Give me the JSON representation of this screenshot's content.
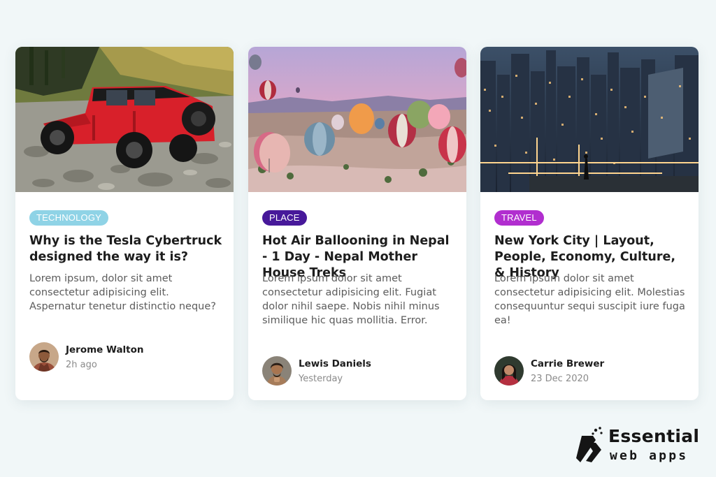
{
  "cards": [
    {
      "image": "red-jeep-on-rocky-riverbed",
      "category": "TECHNOLOGY",
      "category_color": "#8fd3e6",
      "title": "Why is the Tesla Cybertruck designed the way it is?",
      "excerpt": "Lorem ipsum, dolor sit amet consectetur adipisicing elit. Aspernatur tenetur distinctio neque?",
      "author": {
        "name": "Jerome Walton",
        "time": "2h ago"
      }
    },
    {
      "image": "hot-air-balloons-at-sunrise",
      "category": "PLACE",
      "category_color": "#47199a",
      "title": "Hot Air Ballooning in Nepal - 1 Day - Nepal Mother House Treks",
      "excerpt": "Lorem ipsum dolor sit amet consectetur adipisicing elit. Fugiat dolor nihil saepe. Nobis nihil minus similique hic quas mollitia. Error.",
      "author": {
        "name": "Lewis Daniels",
        "time": "Yesterday"
      }
    },
    {
      "image": "new-york-city-skyline-at-night",
      "category": "TRAVEL",
      "category_color": "#b12ecf",
      "title": "New York City | Layout, People, Economy, Culture, & History",
      "excerpt": "Lorem ipsum dolor sit amet consectetur adipisicing elit. Molestias consequuntur sequi suscipit iure fuga ea!",
      "author": {
        "name": "Carrie Brewer",
        "time": "23 Dec 2020"
      }
    }
  ],
  "brand": {
    "line1": "Essential",
    "line2": "web apps",
    "icon": "essential-web-apps-logo-icon"
  }
}
